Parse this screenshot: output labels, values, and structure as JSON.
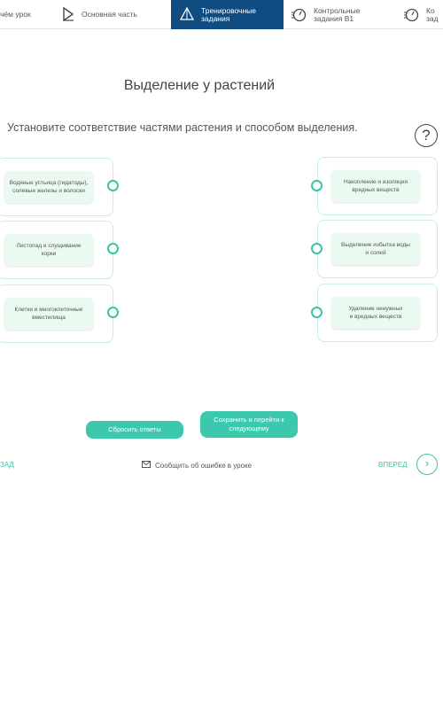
{
  "nav": {
    "tabs": [
      {
        "label": "чём урок"
      },
      {
        "label": "Основная часть"
      },
      {
        "label_line1": "Тренировочные",
        "label_line2": "задания"
      },
      {
        "label_line1": "Контрольные",
        "label_line2": "задания В1"
      },
      {
        "label_line1": "Ко",
        "label_line2": "зад"
      }
    ]
  },
  "lesson": {
    "title": "Выделение у растений",
    "task": "Установите соответствие частями растения и способом выделения.",
    "help_label": "?"
  },
  "left_items": [
    {
      "line1": "Водяные устьица (гидатоды),",
      "line2": "солевые железы и волоски"
    },
    {
      "line1": "Листопад и слущивание",
      "line2": "корки"
    },
    {
      "line1": "Клетки и многоклеточные",
      "line2": "вместилища"
    }
  ],
  "right_items": [
    {
      "line1": "Накопление и изоляция",
      "line2": "вредных веществ"
    },
    {
      "line1": "Выделение избытка воды",
      "line2": "и солей"
    },
    {
      "line1": "Удаление ненужных",
      "line2": "и вредных веществ"
    }
  ],
  "actions": {
    "reset_label": "Сбросить ответы",
    "save_line1": "Сохранить и перейти к",
    "save_line2": "следующему"
  },
  "footer": {
    "back_label": "ЗАД",
    "report_label": "Сообщить об ошибке в уроке",
    "next_label": "ВПЕРЕД",
    "next_arrow": "›"
  },
  "colors": {
    "accent": "#3cc8ad",
    "active_tab": "#0f4c81",
    "card_fill": "#eafaf0"
  }
}
